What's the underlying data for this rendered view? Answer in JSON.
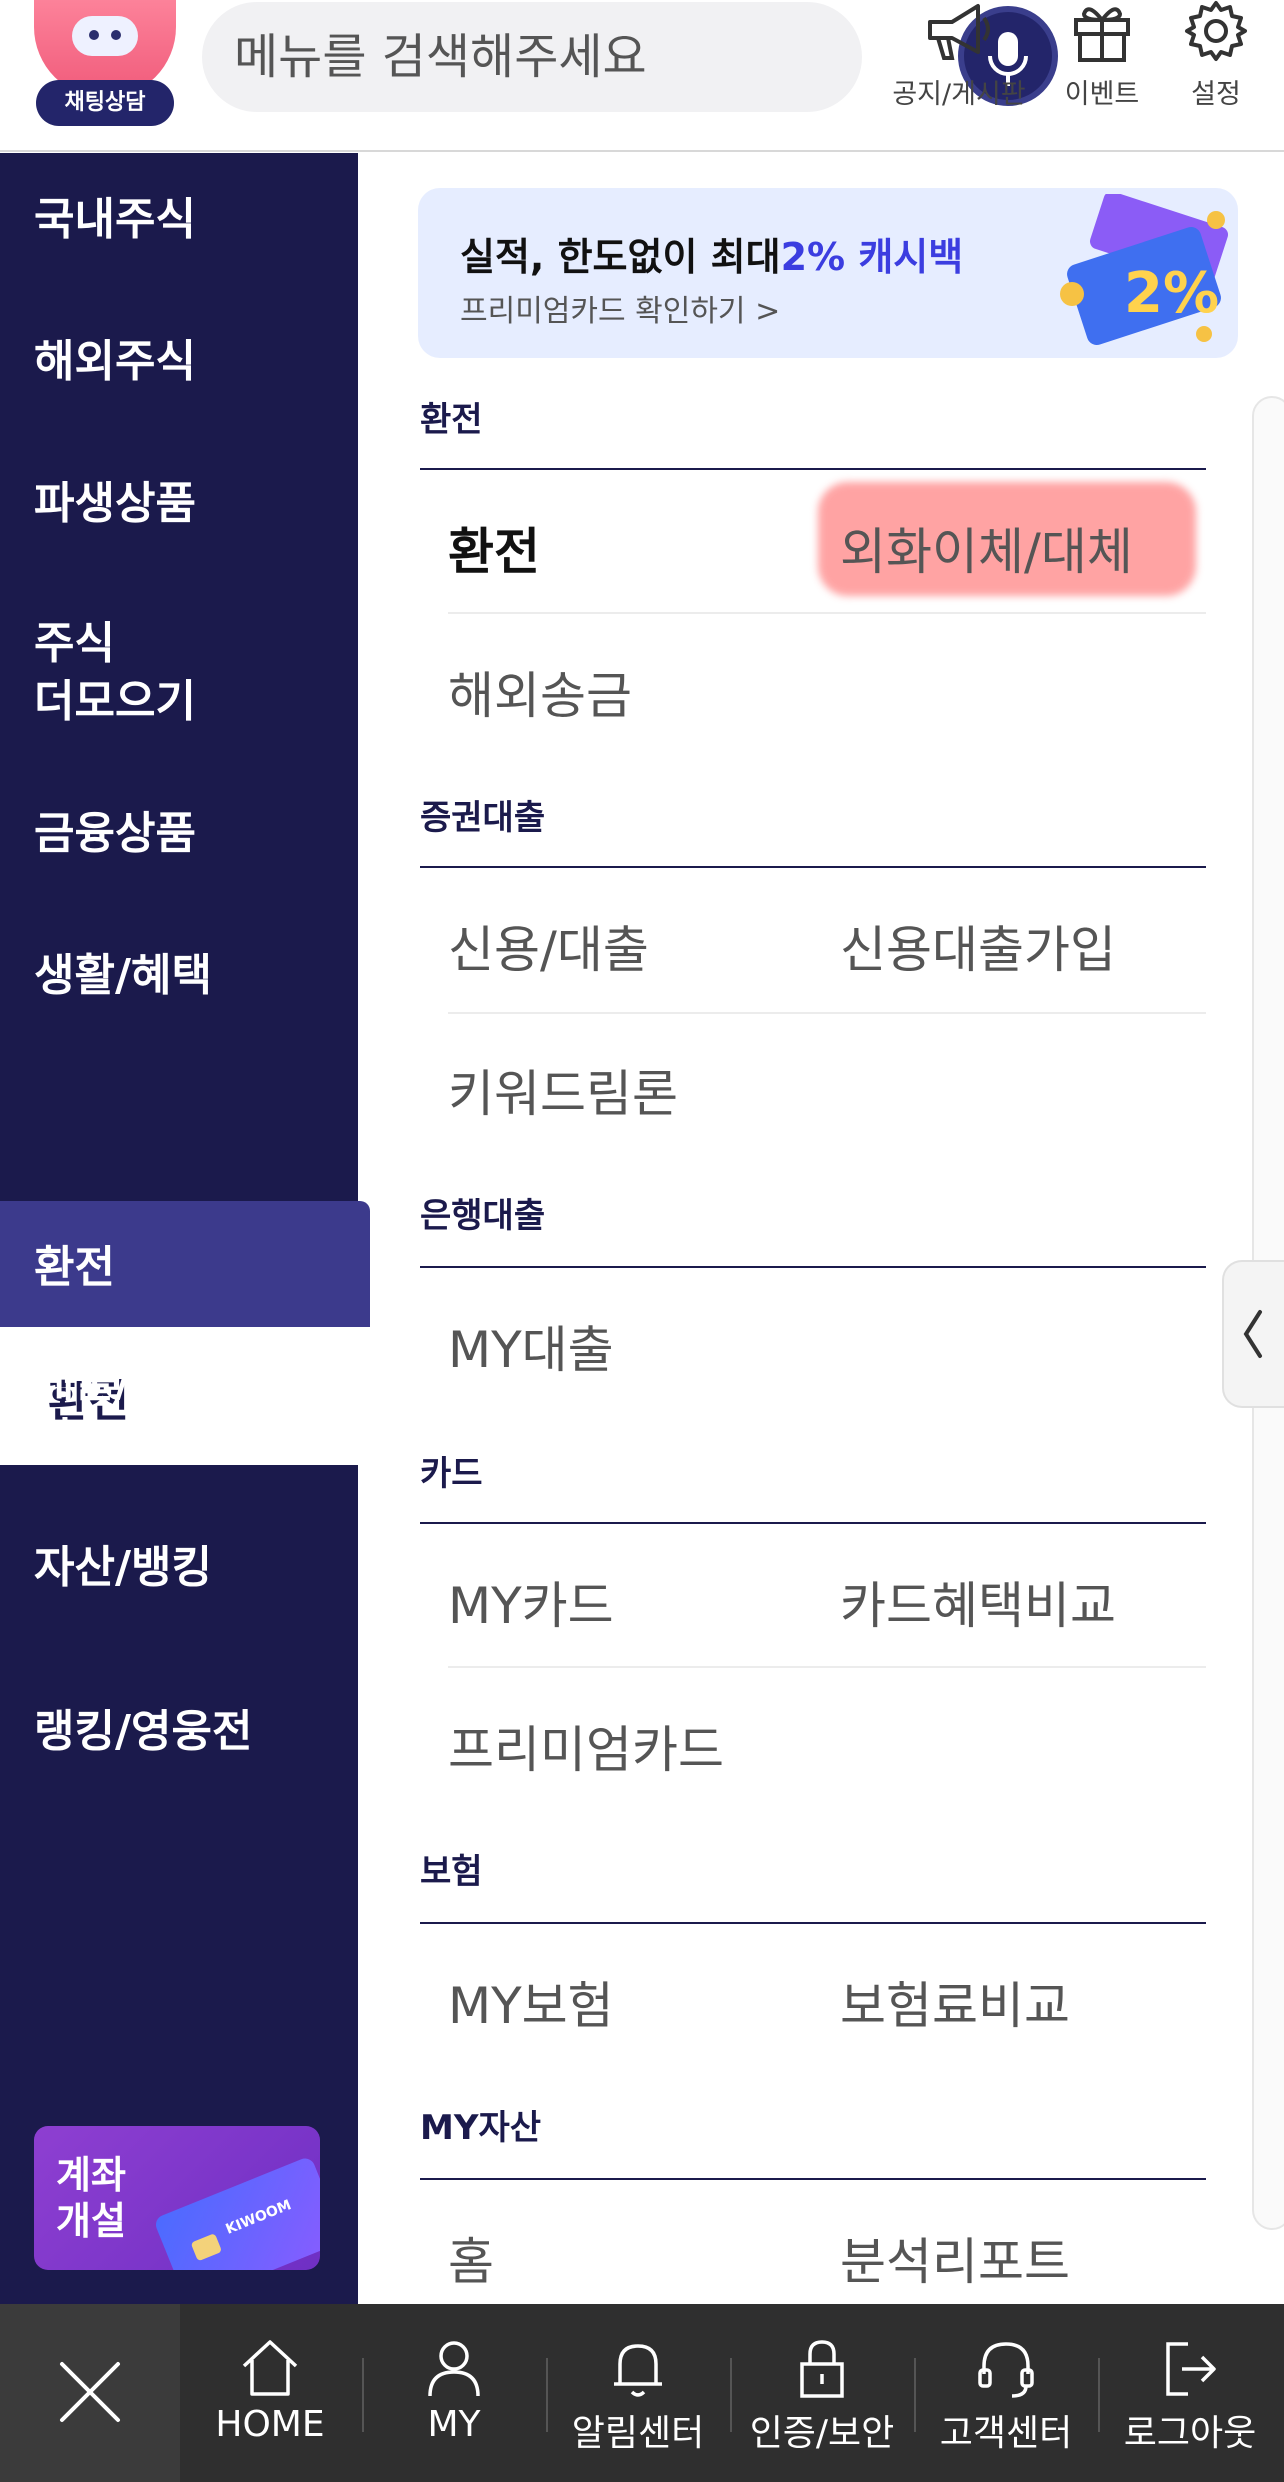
{
  "header": {
    "chatbot_label": "채팅상담",
    "search_placeholder": "메뉴를 검색해주세요",
    "icons": [
      {
        "label": "공지/게시판",
        "icon": "megaphone-icon"
      },
      {
        "label": "이벤트",
        "icon": "gift-icon"
      },
      {
        "label": "설정",
        "icon": "gear-icon"
      }
    ]
  },
  "sidebar": {
    "items": [
      {
        "label": "국내주식"
      },
      {
        "label": "해외주식"
      },
      {
        "label": "파생상품"
      },
      {
        "label": "주식\n더모으기"
      },
      {
        "label": "금융상품"
      },
      {
        "label": "생활/혜택"
      },
      {
        "label": "환전"
      },
      {
        "label": "대출/\n카드/보험"
      },
      {
        "label": "자산/뱅킹"
      },
      {
        "label": "랭킹/영웅전"
      }
    ],
    "active": "환전",
    "active_sub": "환전",
    "account_button": "계좌\n개설",
    "account_card_brand": "KIWOOM"
  },
  "banner": {
    "title_prefix": "실적, 한도없이 최대",
    "title_highlight": "2% 캐시백",
    "subtitle": "프리미엄카드 확인하기 >",
    "art_text": "2%"
  },
  "sections": [
    {
      "title": "환전",
      "items": [
        "환전",
        "외화이체/대체",
        "해외송금"
      ]
    },
    {
      "title": "증권대출",
      "items": [
        "신용/대출",
        "신용대출가입",
        "키워드림론"
      ]
    },
    {
      "title": "은행대출",
      "items": [
        "MY대출"
      ]
    },
    {
      "title": "카드",
      "items": [
        "MY카드",
        "카드혜택비교",
        "프리미엄카드"
      ]
    },
    {
      "title": "보험",
      "items": [
        "MY보험",
        "보험료비교"
      ]
    },
    {
      "title": "MY자산",
      "items": [
        "홈",
        "분석리포트"
      ]
    }
  ],
  "bottom_nav": [
    {
      "label": "HOME",
      "icon": "home-icon"
    },
    {
      "label": "MY",
      "icon": "person-icon"
    },
    {
      "label": "알림센터",
      "icon": "bell-icon"
    },
    {
      "label": "인증/보안",
      "icon": "lock-icon"
    },
    {
      "label": "고객센터",
      "icon": "headset-icon"
    },
    {
      "label": "로그아웃",
      "icon": "logout-icon"
    }
  ],
  "colors": {
    "navy": "#1b1a4c",
    "active": "#3c3a8c",
    "highlight": "#ff9a9a",
    "accent": "#3b3de0"
  }
}
